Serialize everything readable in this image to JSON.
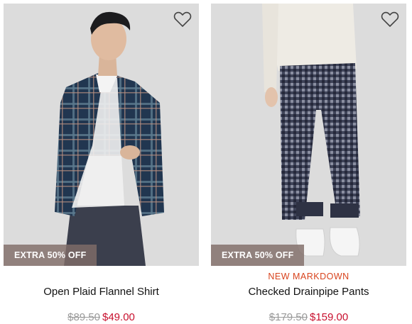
{
  "products": [
    {
      "badge": "EXTRA 50% OFF",
      "tag": "",
      "name": "Open Plaid Flannel Shirt",
      "original_price": "$89.50",
      "sale_price": "$49.00",
      "image_icon": "flannel-shirt-photo"
    },
    {
      "badge": "EXTRA 50% OFF",
      "tag": "NEW MARKDOWN",
      "name": "Checked Drainpipe Pants",
      "original_price": "$179.50",
      "sale_price": "$159.00",
      "image_icon": "drainpipe-pants-photo"
    }
  ],
  "colors": {
    "badge_bg": "#806c68",
    "tag": "#d8431d",
    "sale_price": "#c8102e",
    "original_price": "#9a9a9a",
    "photo_bg": "#dcdcdc"
  }
}
